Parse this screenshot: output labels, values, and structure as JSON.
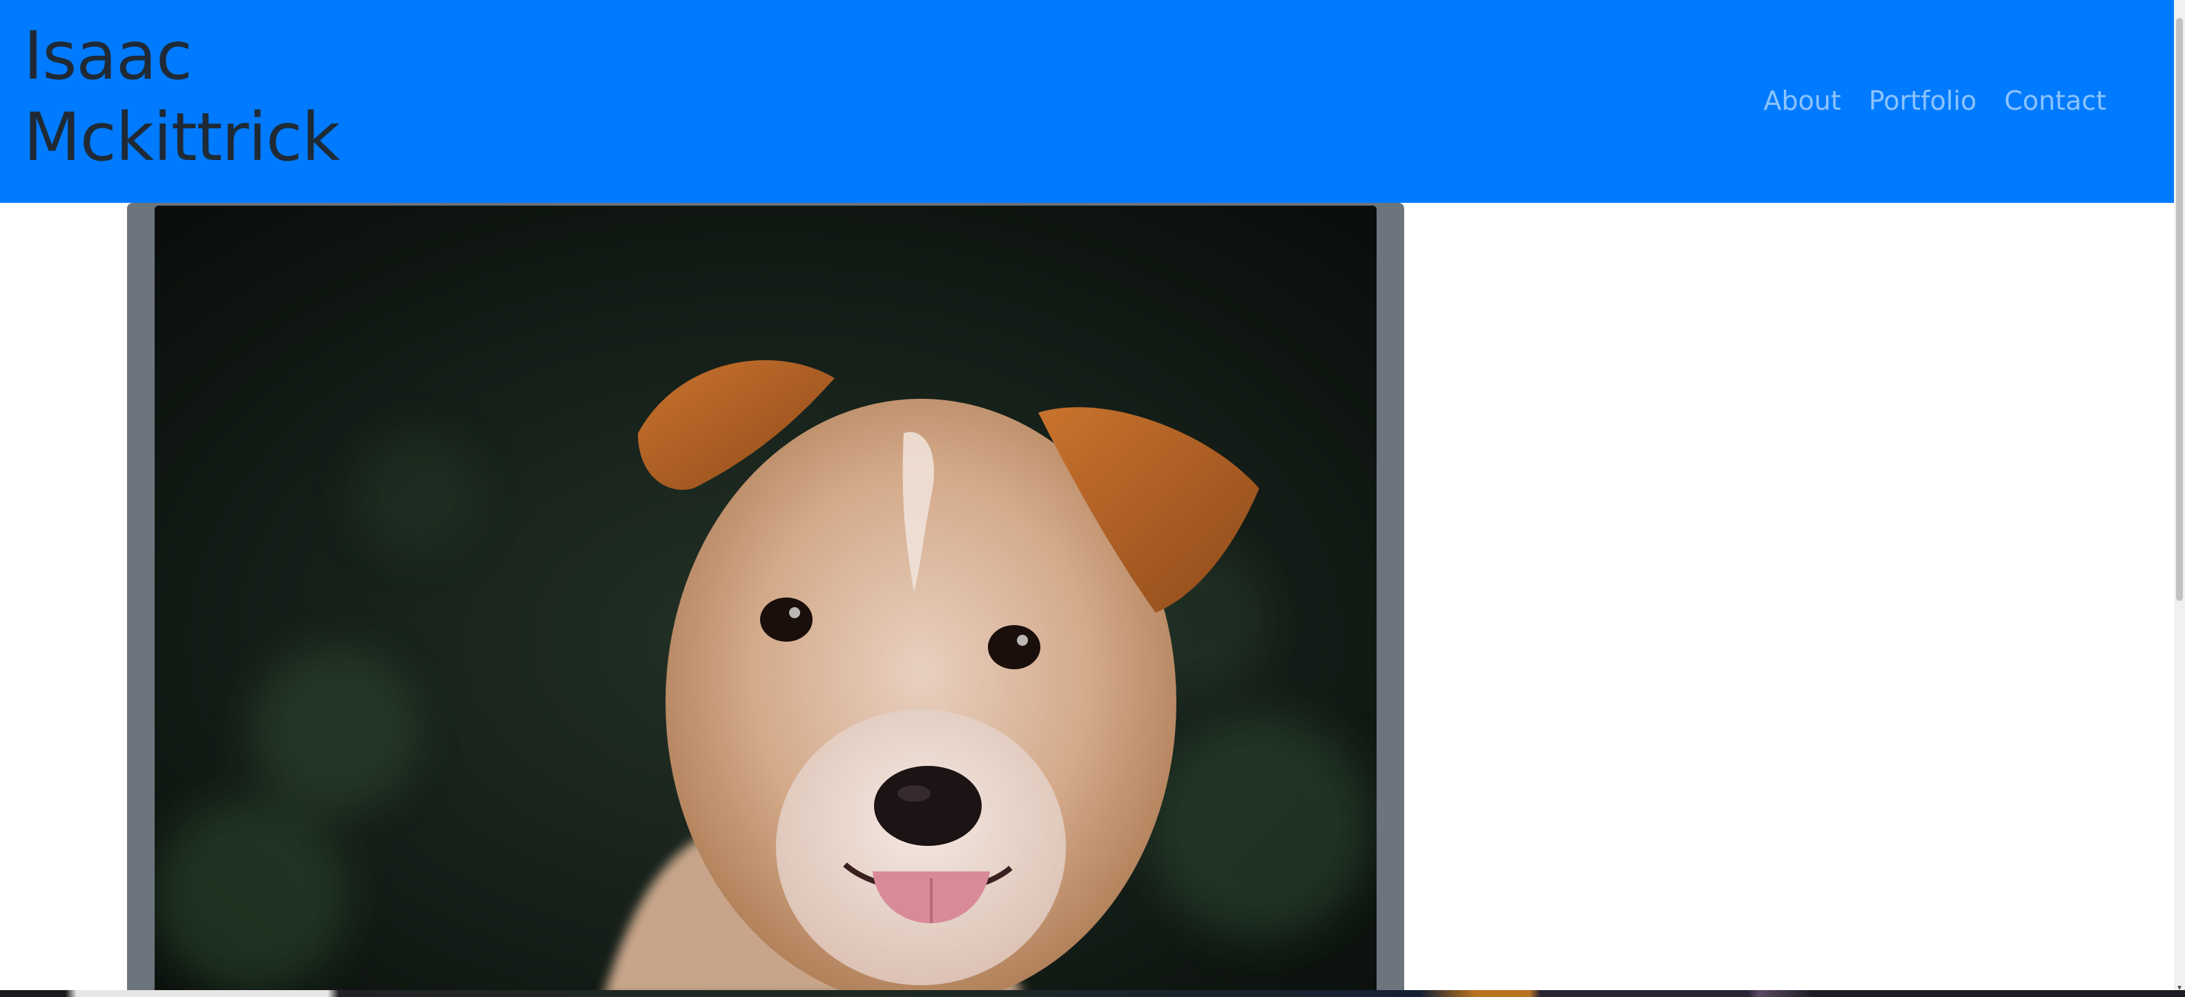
{
  "header": {
    "brand_line1": "Isaac",
    "brand_line2": "Mckittrick",
    "nav": [
      {
        "label": "About"
      },
      {
        "label": "Portfolio"
      },
      {
        "label": "Contact"
      }
    ]
  },
  "colors": {
    "navbar_bg": "#007bff",
    "brand_text": "#1f2a36",
    "nav_link": "rgba(255,255,255,0.55)",
    "card_bg": "#6c757d"
  },
  "card": {
    "image_subject": "puppy-photo"
  }
}
